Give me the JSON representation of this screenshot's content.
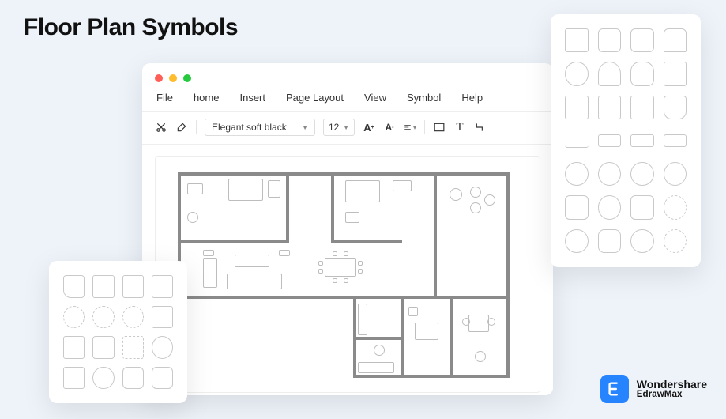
{
  "title": "Floor Plan Symbols",
  "menubar": {
    "file": "File",
    "home": "home",
    "insert": "Insert",
    "page_layout": "Page Layout",
    "view": "View",
    "symbol": "Symbol",
    "help": "Help"
  },
  "toolbar": {
    "font_name": "Elegant soft black",
    "font_size": "12"
  },
  "brand": {
    "line1": "Wondershare",
    "line2": "EdrawMax"
  },
  "palettes": {
    "right_symbol_count": 28,
    "left_symbol_count": 16
  }
}
